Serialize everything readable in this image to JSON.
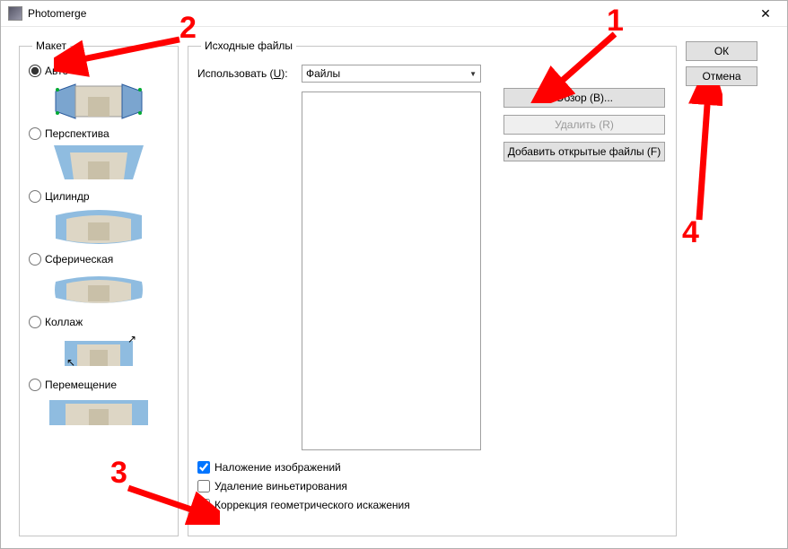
{
  "window": {
    "title": "Photomerge"
  },
  "layout": {
    "legend": "Макет",
    "options": {
      "auto": "Авто",
      "perspective": "Перспектива",
      "cylinder": "Цилиндр",
      "spherical": "Сферическая",
      "collage": "Коллаж",
      "reposition": "Перемещение"
    },
    "selected": "auto"
  },
  "source": {
    "legend": "Исходные файлы",
    "use_label_pre": "Использовать (",
    "use_label_u": "U",
    "use_label_post": "):",
    "use_value": "Файлы",
    "browse": "Обзор (B)...",
    "remove": "Удалить (R)",
    "add_open": "Добавить открытые файлы (F)"
  },
  "checks": {
    "blend": "Наложение изображений",
    "vignette": "Удаление виньетирования",
    "geometric": "Коррекция геометрического искажения"
  },
  "buttons": {
    "ok": "ОК",
    "cancel": "Отмена"
  },
  "annotations": {
    "n1": "1",
    "n2": "2",
    "n3": "3",
    "n4": "4"
  }
}
